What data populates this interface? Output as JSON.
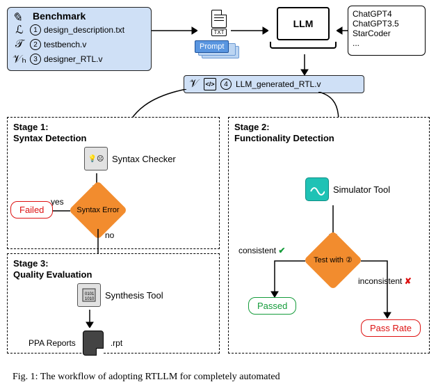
{
  "benchmark": {
    "title": "Benchmark",
    "rows": [
      {
        "symbol": "ℒ",
        "num": "1",
        "file": "design_description.txt"
      },
      {
        "symbol": "𝒯",
        "num": "2",
        "file": "testbench.v"
      },
      {
        "symbol": "𝒱ₕ",
        "num": "3",
        "file": "designer_RTL.v"
      }
    ]
  },
  "txt_badge": "TXT",
  "prompt_label": "Prompt",
  "laptop_label": "LLM",
  "llm_list": [
    "ChatGPT4",
    "ChatGPT3.5",
    "StarCoder",
    "..."
  ],
  "generated": {
    "symbol": "𝒱",
    "num": "4",
    "file": "LLM_generated_RTL.v"
  },
  "stage1": {
    "title1": "Stage 1:",
    "title2": "Syntax Detection",
    "tool": "Syntax Checker",
    "diamond": "Syntax Error",
    "yes": "yes",
    "no": "no",
    "fail": "Failed"
  },
  "stage2": {
    "title1": "Stage 2:",
    "title2": "Functionality Detection",
    "tool": "Simulator Tool",
    "diamond": "Test with ②",
    "consistent": "consistent",
    "inconsistent": "inconsistent",
    "pass": "Passed",
    "rate": "Pass Rate"
  },
  "stage3": {
    "title1": "Stage 3:",
    "title2": "Quality Evaluation",
    "tool": "Synthesis Tool",
    "out": "PPA Reports",
    "ext": ".rpt"
  },
  "caption": "Fig. 1: The workflow of adopting RTLLM for completely automated"
}
